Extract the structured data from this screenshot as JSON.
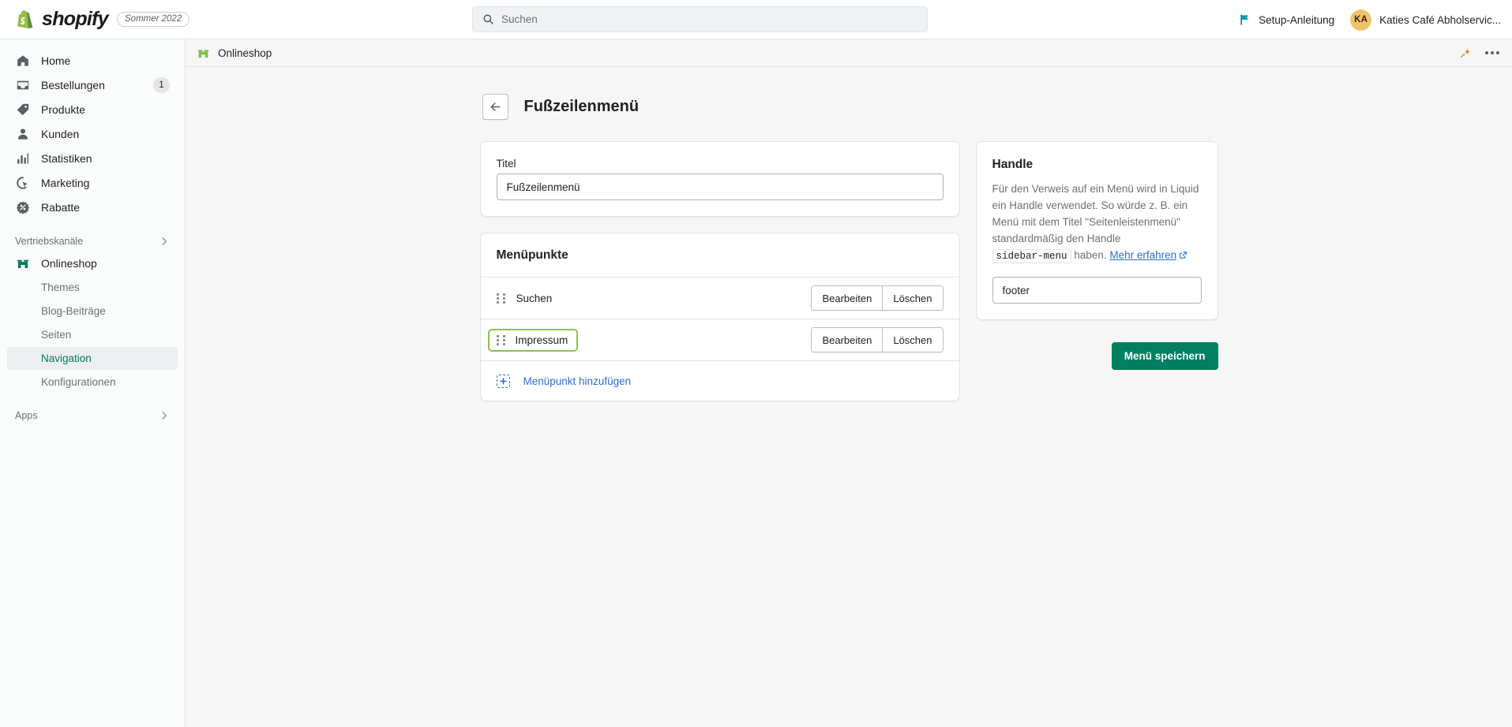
{
  "topbar": {
    "logo_name": "shopify-logo",
    "wordmark": "shopify",
    "version_badge": "Sommer 2022",
    "search": {
      "placeholder": "Suchen",
      "value": ""
    },
    "setup_guide_label": "Setup-Anleitung",
    "account": {
      "initials": "KA",
      "name": "Katies Café Abholservic..."
    }
  },
  "sidebar": {
    "items": [
      {
        "label": "Home",
        "icon": "home-icon",
        "badge": ""
      },
      {
        "label": "Bestellungen",
        "icon": "orders-icon",
        "badge": "1"
      },
      {
        "label": "Produkte",
        "icon": "products-icon",
        "badge": ""
      },
      {
        "label": "Kunden",
        "icon": "customers-icon",
        "badge": ""
      },
      {
        "label": "Statistiken",
        "icon": "analytics-icon",
        "badge": ""
      },
      {
        "label": "Marketing",
        "icon": "marketing-icon",
        "badge": ""
      },
      {
        "label": "Rabatte",
        "icon": "discounts-icon",
        "badge": ""
      }
    ],
    "sales_channels_group": "Vertriebskanäle",
    "online_store": {
      "label": "Onlineshop",
      "icon": "storefront-icon"
    },
    "sub_items": [
      {
        "label": "Themes",
        "active": false
      },
      {
        "label": "Blog-Beiträge",
        "active": false
      },
      {
        "label": "Seiten",
        "active": false
      },
      {
        "label": "Navigation",
        "active": true
      },
      {
        "label": "Konfigurationen",
        "active": false
      }
    ],
    "apps_group": "Apps"
  },
  "context_bar": {
    "channel_label": "Onlineshop",
    "channel_icon": "storefront-icon",
    "pin_icon": "pin-icon",
    "more_icon": "ellipsis-icon"
  },
  "page": {
    "back_label": "back-arrow",
    "title": "Fußzeilenmenü",
    "title_card": {
      "label": "Titel",
      "value": "Fußzeilenmenü",
      "placeholder": ""
    },
    "menu_items_card": {
      "title": "Menüpunkte",
      "rows": [
        {
          "label": "Suchen",
          "edit": "Bearbeiten",
          "delete": "Löschen",
          "focused": false
        },
        {
          "label": "Impressum",
          "edit": "Bearbeiten",
          "delete": "Löschen",
          "focused": true
        }
      ],
      "add_label": "Menüpunkt hinzufügen"
    },
    "handle_card": {
      "title": "Handle",
      "desc_part1": "Für den Verweis auf ein Menü wird in Liquid ein Handle verwendet. So würde z. B. ein Menü mit dem Titel \"Seitenleistenmenü\" standardmäßig den Handle",
      "code": "sidebar-menu",
      "desc_part2": "haben.",
      "learn_more": "Mehr erfahren",
      "value": "footer",
      "placeholder": ""
    },
    "save_button": "Menü speichern"
  },
  "colors": {
    "brand_green": "#008060",
    "focus_green": "#8bc34a",
    "link_blue": "#2c6ecb",
    "accent_orange": "#e0820a",
    "sidebar_bg": "#fafbfb",
    "page_bg": "#f6f6f7"
  }
}
